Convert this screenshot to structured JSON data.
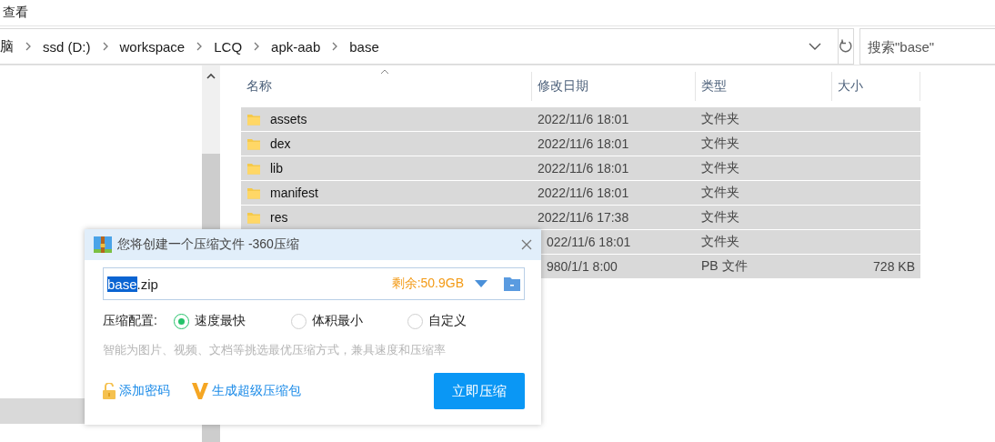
{
  "menu": {
    "items": [
      {
        "label": "查看"
      }
    ]
  },
  "address_bar": {
    "crumbs": [
      "脑",
      "ssd (D:)",
      "workspace",
      "LCQ",
      "apk-aab",
      "base"
    ]
  },
  "search": {
    "placeholder": "搜索\"base\""
  },
  "table": {
    "columns": [
      "名称",
      "修改日期",
      "类型",
      "大小"
    ],
    "rows": [
      {
        "name": "assets",
        "date": "2022/11/6 18:01",
        "type": "文件夹",
        "size": "",
        "selected": true
      },
      {
        "name": "dex",
        "date": "2022/11/6 18:01",
        "type": "文件夹",
        "size": "",
        "selected": true
      },
      {
        "name": "lib",
        "date": "2022/11/6 18:01",
        "type": "文件夹",
        "size": "",
        "selected": true
      },
      {
        "name": "manifest",
        "date": "2022/11/6 18:01",
        "type": "文件夹",
        "size": "",
        "selected": true
      },
      {
        "name": "res",
        "date": "2022/11/6 17:38",
        "type": "文件夹",
        "size": "",
        "selected": true
      },
      {
        "name": "",
        "date": "022/11/6 18:01",
        "type": "文件夹",
        "size": "",
        "selected": true
      },
      {
        "name": "",
        "date": "980/1/1 8:00",
        "type": "PB 文件",
        "size": "728 KB",
        "selected": true
      }
    ]
  },
  "dialog": {
    "title": "您将创建一个压缩文件 -360压缩",
    "filename": {
      "selected_text": "base",
      "rest_text": ".zip"
    },
    "free_space": "剩余:50.9GB",
    "config_label": "压缩配置:",
    "options": [
      {
        "label": "速度最快",
        "selected": true
      },
      {
        "label": "体积最小",
        "selected": false
      },
      {
        "label": "自定义",
        "selected": false
      }
    ],
    "hint": "智能为图片、视频、文档等挑选最优压缩方式，兼具速度和压缩率",
    "links": [
      "添加密码",
      "生成超级压缩包"
    ],
    "primary_button": "立即压缩"
  }
}
